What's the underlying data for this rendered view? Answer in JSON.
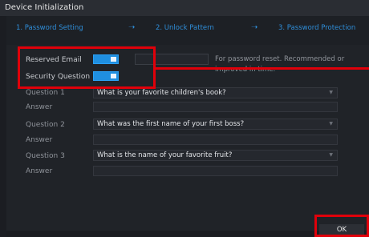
{
  "window": {
    "title": "Device Initialization"
  },
  "steps": [
    {
      "label": "1.  Password Setting"
    },
    {
      "label": "2.  Unlock Pattern"
    },
    {
      "label": "3.  Password Protection"
    }
  ],
  "step_arrow": "➝",
  "reserved_email": {
    "label": "Reserved Email",
    "enabled": true,
    "value": "",
    "hint_line1": "For password reset. Recommended or",
    "hint_line2": "improved in time."
  },
  "security_question": {
    "label": "Security Question",
    "enabled": true
  },
  "questions": [
    {
      "label": "Question 1",
      "value": "What is your favorite children's book?",
      "answer_label": "Answer",
      "answer_value": ""
    },
    {
      "label": "Question 2",
      "value": "What was the first name of your first boss?",
      "answer_label": "Answer",
      "answer_value": ""
    },
    {
      "label": "Question 3",
      "value": "What is the name of your favorite fruit?",
      "answer_label": "Answer",
      "answer_value": ""
    }
  ],
  "dropdown_caret": "▼",
  "buttons": {
    "ok": "OK"
  },
  "colors": {
    "accent": "#1f8fe0",
    "highlight": "#e0000a",
    "background": "#202328"
  }
}
